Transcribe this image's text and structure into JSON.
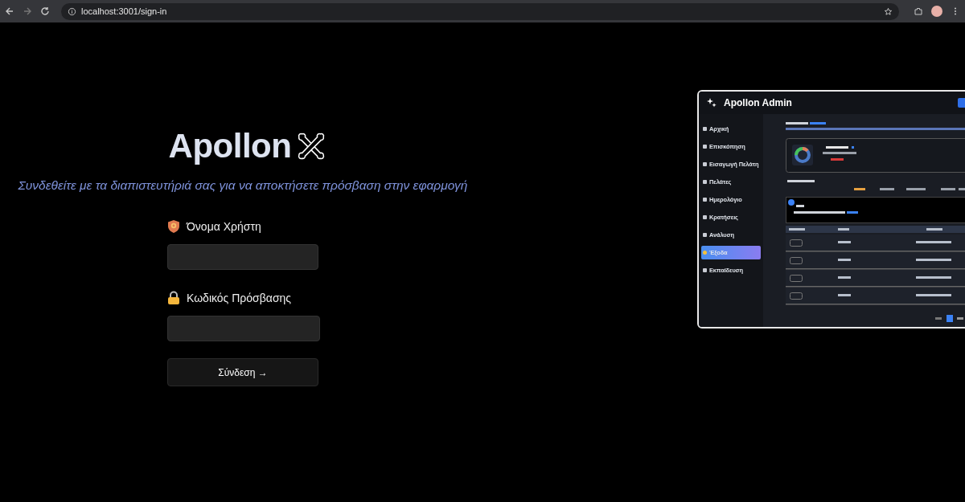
{
  "browser": {
    "url": "localhost:3001/sign-in"
  },
  "login": {
    "logo": "Apollon",
    "subtitle": "Συνδεθείτε με τα διαπιστευτήριά σας για να αποκτήσετε πρόσβαση στην εφαρμογή",
    "fields": [
      {
        "kind": "username",
        "label": "Όνομα Χρήστη"
      },
      {
        "kind": "password",
        "label": "Κωδικός Πρόσβασης"
      }
    ],
    "submit": "Σύνδεση →"
  },
  "preview": {
    "title": "Apollon Admin",
    "sidebar": [
      {
        "label": "Αρχική",
        "selected": false
      },
      {
        "label": "Επισκόπηση",
        "selected": false
      },
      {
        "label": "Εισαγωγή Πελάτη",
        "selected": false
      },
      {
        "label": "Πελάτες",
        "selected": false
      },
      {
        "label": "Ημερολόγιο",
        "selected": false
      },
      {
        "label": "Κρατήσεις",
        "selected": false
      },
      {
        "label": "Ανάλυση",
        "selected": false
      },
      {
        "label": "Έξοδα",
        "selected": true
      },
      {
        "label": "Εκπαίδευση",
        "selected": false
      }
    ]
  }
}
